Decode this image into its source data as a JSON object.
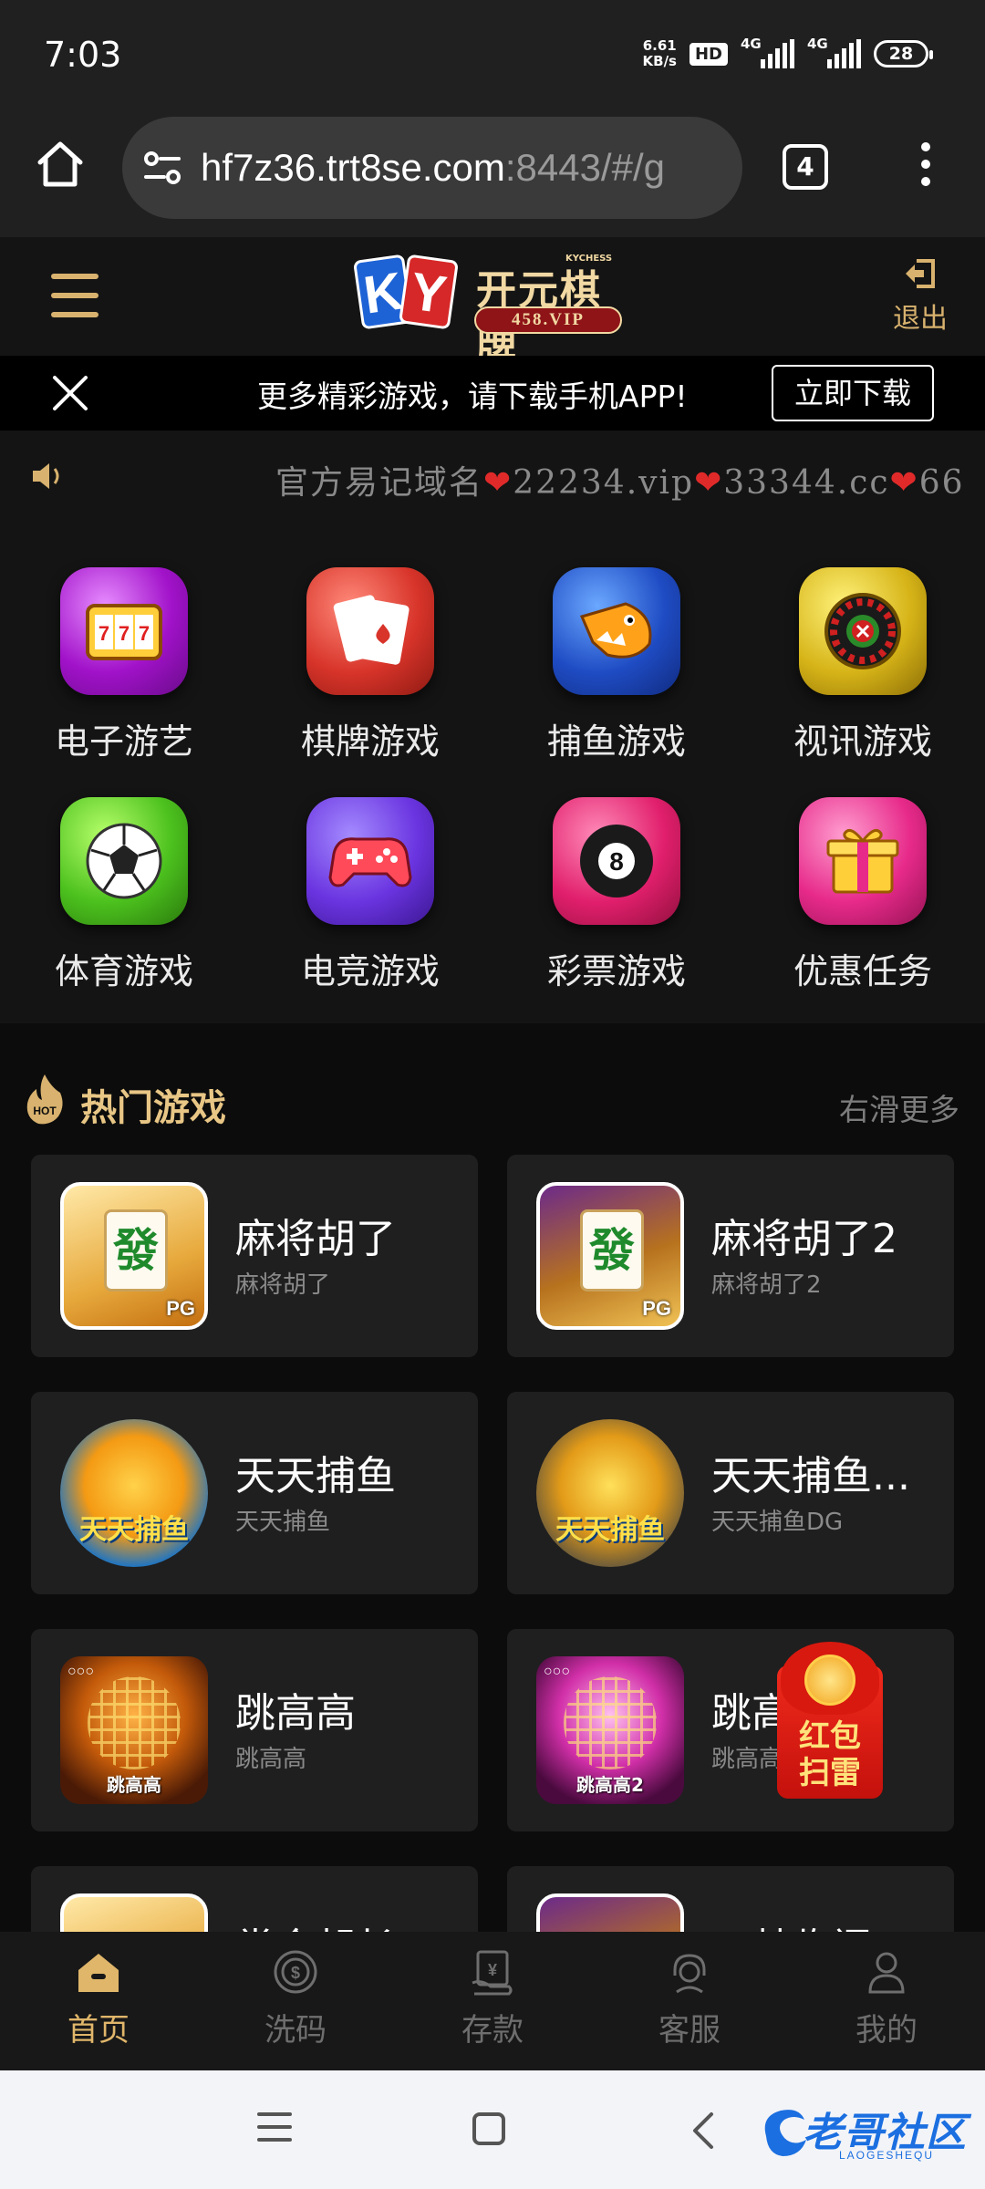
{
  "status_bar": {
    "time": "7:03",
    "speed_value": "6.61",
    "speed_unit": "KB/s",
    "hd": "HD",
    "net1": "4G",
    "net2": "4G",
    "battery": "28"
  },
  "browser": {
    "url_main": "hf7z36.trt8se.com",
    "url_rest": ":8443/#/g",
    "tab_count": "4"
  },
  "header": {
    "logo_en": "KY",
    "logo_cn": "开元棋牌",
    "logo_kychess": "KYCHESS",
    "logo_vip": "458.VIP",
    "logout_label": "退出"
  },
  "download_banner": {
    "text": "更多精彩游戏，请下载手机APP!",
    "button": "立即下载"
  },
  "marquee": {
    "prefix": "官方易记域名",
    "domain1": "22234.vip",
    "domain2": "33344.cc",
    "domain3": "66"
  },
  "categories": [
    {
      "label": "电子游艺",
      "icon": "slot-machine-icon"
    },
    {
      "label": "棋牌游戏",
      "icon": "playing-cards-icon"
    },
    {
      "label": "捕鱼游戏",
      "icon": "fish-icon"
    },
    {
      "label": "视讯游戏",
      "icon": "roulette-icon"
    },
    {
      "label": "体育游戏",
      "icon": "soccer-ball-icon"
    },
    {
      "label": "电竞游戏",
      "icon": "gamepad-icon"
    },
    {
      "label": "彩票游戏",
      "icon": "billiard-ball-icon"
    },
    {
      "label": "优惠任务",
      "icon": "gift-icon"
    }
  ],
  "hot": {
    "badge": "HOT",
    "title": "热门游戏",
    "more": "右滑更多",
    "games": [
      {
        "name": "麻将胡了",
        "sub": "麻将胡了",
        "thumb_tile": "發",
        "thumb_tag": "PG"
      },
      {
        "name": "麻将胡了2",
        "sub": "麻将胡了2",
        "thumb_tile": "發",
        "thumb_tag": "PG"
      },
      {
        "name": "天天捕鱼",
        "sub": "天天捕鱼",
        "thumb_text": "天天捕鱼"
      },
      {
        "name": "天天捕鱼...",
        "sub": "天天捕鱼DG",
        "thumb_text": "天天捕鱼"
      },
      {
        "name": "跳高高",
        "sub": "跳高高",
        "thumb_text": "跳高高"
      },
      {
        "name": "跳高",
        "sub": "跳高高",
        "thumb_text": "跳高高2"
      },
      {
        "name": "掌金朝长",
        "sub": ""
      },
      {
        "name": "四禁临门",
        "sub": ""
      }
    ]
  },
  "red_packet": {
    "text_line1": "红包",
    "text_line2": "扫雷"
  },
  "bottom_nav": [
    {
      "label": "首页",
      "icon": "home-icon",
      "active": true
    },
    {
      "label": "洗码",
      "icon": "dollar-coin-icon",
      "active": false
    },
    {
      "label": "存款",
      "icon": "deposit-icon",
      "active": false
    },
    {
      "label": "客服",
      "icon": "support-headset-icon",
      "active": false
    },
    {
      "label": "我的",
      "icon": "user-icon",
      "active": false
    }
  ],
  "watermark": {
    "text": "老哥社区",
    "sub": "LAOGESHEQU"
  },
  "colors": {
    "accent_gold": "#e0b66a",
    "background": "#141414",
    "card": "#1f1f1f",
    "marquee_heart": "#e02a2a"
  }
}
